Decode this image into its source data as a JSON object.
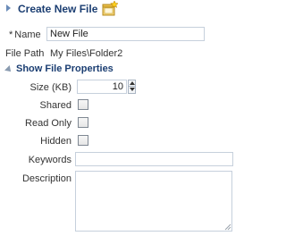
{
  "header": {
    "title": "Create New File",
    "icon": "new-file-icon"
  },
  "form": {
    "name": {
      "required_marker": "*",
      "label": "Name",
      "value": "New File"
    },
    "file_path": {
      "label": "File Path",
      "value": "My Files\\Folder2"
    }
  },
  "properties": {
    "section_title": "Show File Properties",
    "expanded": true,
    "size": {
      "label": "Size (KB)",
      "value": "10"
    },
    "shared": {
      "label": "Shared",
      "checked": false
    },
    "read_only": {
      "label": "Read Only",
      "checked": false
    },
    "hidden": {
      "label": "Hidden",
      "checked": false
    },
    "keywords": {
      "label": "Keywords",
      "value": ""
    },
    "description": {
      "label": "Description",
      "value": ""
    }
  },
  "colors": {
    "title": "#1b3e72",
    "input_border": "#c6d0dc",
    "disclosure": "#6a8bb8"
  }
}
